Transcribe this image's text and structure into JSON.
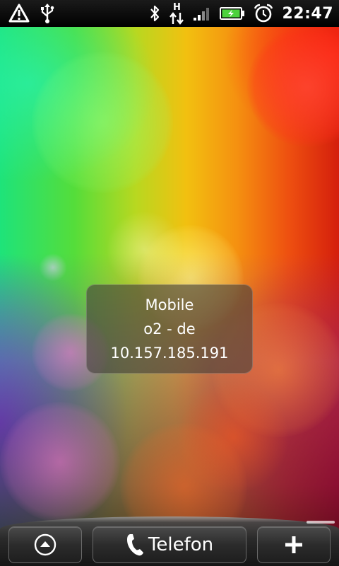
{
  "status_bar": {
    "time": "22:47",
    "left_icons": [
      "warning-icon",
      "usb-icon"
    ],
    "right_icons": [
      "bluetooth-icon",
      "hsdpa-data-icon",
      "signal-icon",
      "battery-charging-icon",
      "alarm-clock-icon"
    ],
    "data_label": "H"
  },
  "widget": {
    "network_type": "Mobile",
    "operator": "o2 - de",
    "ip_address": "10.157.185.191"
  },
  "dock": {
    "phone_label": "Telefon",
    "icons": [
      "all-apps-icon",
      "phone-handset-icon",
      "add-icon"
    ]
  },
  "colors": {
    "status_bar_bg": "#000000",
    "status_icon": "#ffffff",
    "battery_fill": "#4cd23c",
    "dock_bg": "#1e1e1e"
  }
}
